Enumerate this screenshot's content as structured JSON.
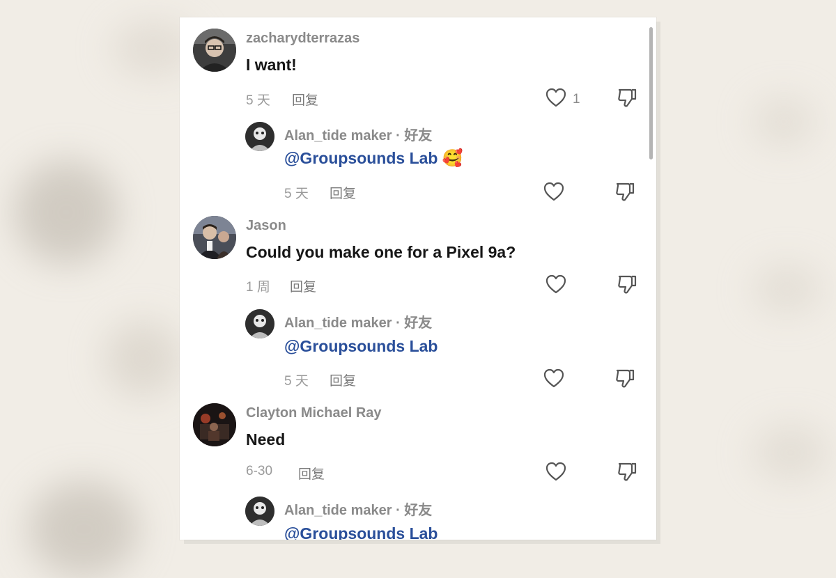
{
  "comments": [
    {
      "user": "zacharydterrazas",
      "text": "I want!",
      "time": "5 天",
      "reply_label": "回复",
      "likes": "1",
      "reply": {
        "user": "Alan_tide maker · 好友",
        "mention": "@Groupsounds Lab",
        "emoji": "🥰",
        "time": "5 天",
        "reply_label": "回复"
      }
    },
    {
      "user": "Jason",
      "text": "Could you make one for a Pixel 9a?",
      "time": "1 周",
      "reply_label": "回复",
      "reply": {
        "user": "Alan_tide maker · 好友",
        "mention": "@Groupsounds Lab",
        "time": "5 天",
        "reply_label": "回复"
      }
    },
    {
      "user": "Clayton Michael Ray",
      "text": "Need",
      "time": "6-30",
      "reply_label": "回复",
      "reply": {
        "user": "Alan_tide maker · 好友",
        "mention": "@Groupsounds Lab"
      }
    }
  ],
  "icons": {
    "like": "heart-outline-icon",
    "dislike": "thumbs-down-icon"
  },
  "colors": {
    "mention": "#2a4f9a",
    "username": "#8a8a8a",
    "text": "#161616"
  }
}
